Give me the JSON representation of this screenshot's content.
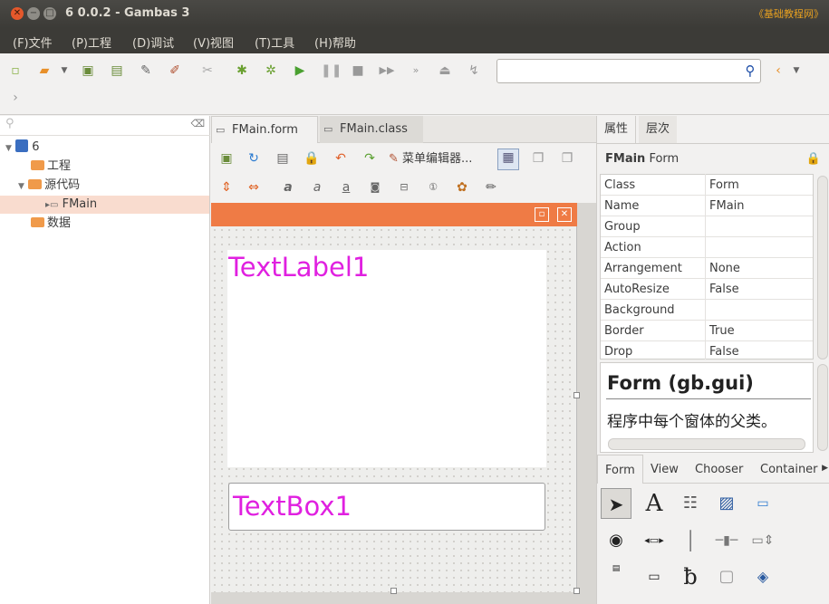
{
  "window": {
    "title": "6 0.0.2 - Gambas 3",
    "watermark": "《基础教程网》"
  },
  "menu": [
    "(F)文件",
    "(P)工程",
    "(D)调试",
    "(V)视图",
    "(T)工具",
    "(H)帮助"
  ],
  "tree": {
    "root": "6",
    "items": [
      "工程",
      "源代码",
      "FMain",
      "数据"
    ]
  },
  "tabs": [
    "FMain.form",
    "FMain.class"
  ],
  "form_toolbar": {
    "menu_editor": "菜单编辑器..."
  },
  "form": {
    "label": "TextLabel1",
    "textbox": "TextBox1"
  },
  "right_tabs": [
    "属性",
    "层次"
  ],
  "props_header": {
    "name": "FMain",
    "type": "Form"
  },
  "properties": [
    {
      "name": "Class",
      "value": "Form"
    },
    {
      "name": "Name",
      "value": "FMain"
    },
    {
      "name": "Group",
      "value": ""
    },
    {
      "name": "Action",
      "value": ""
    },
    {
      "name": "Arrangement",
      "value": "None"
    },
    {
      "name": "AutoResize",
      "value": "False"
    },
    {
      "name": "Background",
      "value": ""
    },
    {
      "name": "Border",
      "value": "True"
    },
    {
      "name": "Drop",
      "value": "False"
    }
  ],
  "help": {
    "title": "Form (gb.gui)",
    "desc": "程序中每个窗体的父类。"
  },
  "component_tabs": [
    "Form",
    "View",
    "Chooser",
    "Container"
  ],
  "colors": {
    "accent": "#ef7b45",
    "control_text": "#e020e0"
  }
}
